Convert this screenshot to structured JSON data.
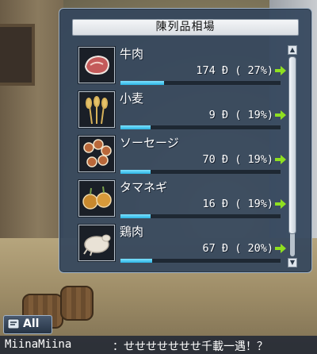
{
  "panel": {
    "title": "陳列品相場"
  },
  "items": [
    {
      "name": "牛肉",
      "price": "174",
      "currency": "Ð",
      "percent": "27%",
      "level": 0.27,
      "icon": "beef-icon"
    },
    {
      "name": "小麦",
      "price": "9",
      "currency": "Ð",
      "percent": "19%",
      "level": 0.19,
      "icon": "wheat-icon"
    },
    {
      "name": "ソーセージ",
      "price": "70",
      "currency": "Ð",
      "percent": "19%",
      "level": 0.19,
      "icon": "sausage-icon"
    },
    {
      "name": "タマネギ",
      "price": "16",
      "currency": "Ð",
      "percent": "19%",
      "level": 0.19,
      "icon": "onion-icon"
    },
    {
      "name": "鶏肉",
      "price": "67",
      "currency": "Ð",
      "percent": "20%",
      "level": 0.2,
      "icon": "chicken-icon"
    }
  ],
  "chat": {
    "tab_label": "All",
    "user": "MiinaMiina",
    "message": "：せせせせせせせ千載一遇！？"
  },
  "colors": {
    "arrow": "#8fe020",
    "bar": "#2bb4e4"
  }
}
